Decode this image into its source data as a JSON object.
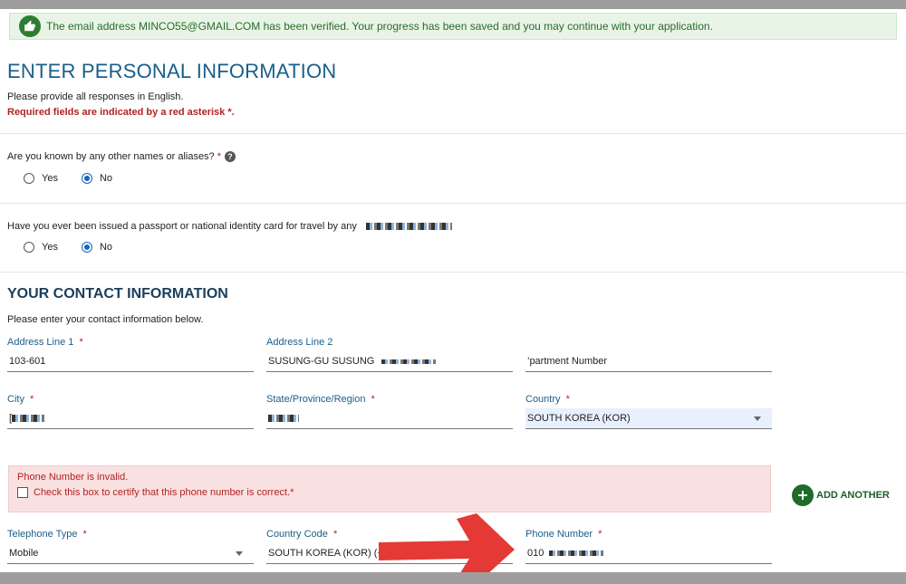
{
  "banner": {
    "message": "The email address MINCO55@GMAIL.COM has been verified. Your progress has been saved and you may continue with your application.",
    "icon": "thumbs-up-icon",
    "color": "#2e7d32"
  },
  "page_title": "ENTER PERSONAL INFORMATION",
  "notes": {
    "language": "Please provide all responses in English.",
    "required": "Required fields are indicated by a red asterisk *."
  },
  "questions": {
    "aliases": {
      "text": "Are you known by any other names or aliases?",
      "asterisk": "*",
      "yes": "Yes",
      "no": "No",
      "selected": "No"
    },
    "passport": {
      "text": "Have you ever been issued a passport or national identity card for travel by any",
      "yes": "Yes",
      "no": "No",
      "selected": "No"
    }
  },
  "contact": {
    "title": "YOUR CONTACT INFORMATION",
    "note": "Please enter your contact information below.",
    "address1": {
      "label": "Address Line 1",
      "asterisk": "*",
      "value": "103-601"
    },
    "address2": {
      "label": "Address Line 2",
      "value": "SUSUNG-GU SUSUNG"
    },
    "apartment": {
      "placeholder": "’partment Number"
    },
    "city": {
      "label": "City",
      "asterisk": "*",
      "value": "["
    },
    "state": {
      "label": "State/Province/Region",
      "asterisk": "*",
      "value": ""
    },
    "country": {
      "label": "Country",
      "asterisk": "*",
      "value": "SOUTH KOREA (KOR)"
    }
  },
  "phone_error": {
    "message": "Phone Number is invalid.",
    "checkbox_label": "Check this box to certify that this phone number is correct.*"
  },
  "add_another": "ADD ANOTHER",
  "phone": {
    "type": {
      "label": "Telephone Type",
      "asterisk": "*",
      "value": "Mobile"
    },
    "country_code": {
      "label": "Country Code",
      "asterisk": "*",
      "value": "SOUTH KOREA (KOR) (+82"
    },
    "number": {
      "label": "Phone Number",
      "asterisk": "*",
      "value": "010"
    }
  },
  "colors": {
    "accent": "#1a5e8a",
    "error": "#b22222",
    "success": "#2e7d32",
    "annotation_arrow": "#e53935"
  }
}
